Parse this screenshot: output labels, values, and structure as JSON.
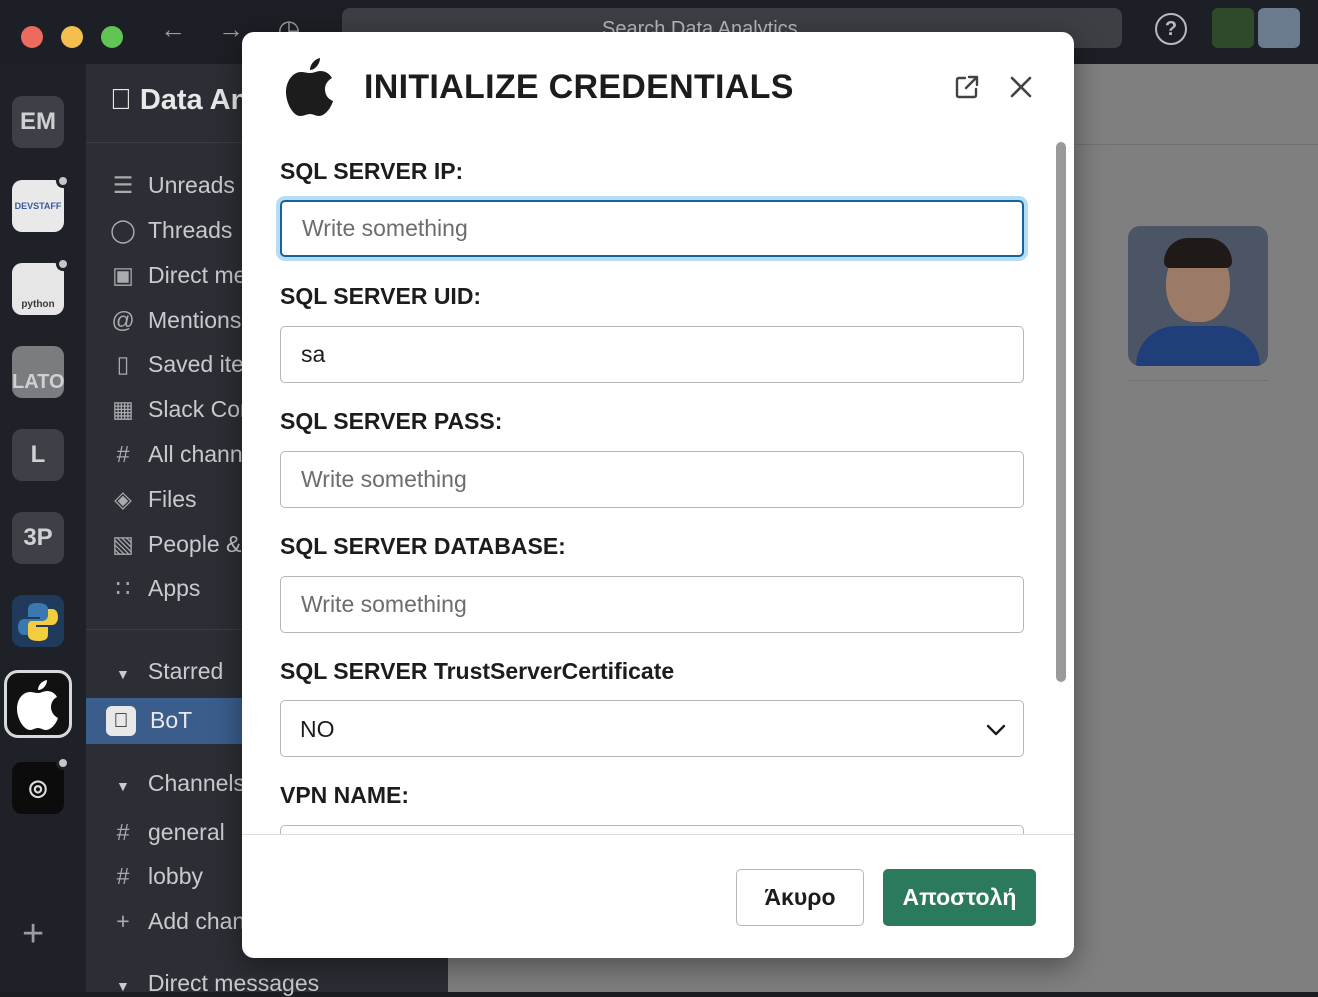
{
  "titlebar": {
    "search_text": "Search  Data Analytics",
    "help_label": "?"
  },
  "workspaces": [
    {
      "label": "EM"
    },
    {
      "label": "DEVSTAFF"
    },
    {
      "label": "python"
    },
    {
      "label": "LATO"
    },
    {
      "label": "L"
    },
    {
      "label": "3P"
    },
    {
      "label": ""
    },
    {
      "label": ""
    },
    {
      "label": ""
    }
  ],
  "workspace_add": "+",
  "sidebar": {
    "workspace_name": "Data Analytics",
    "items": [
      {
        "label": "Unreads",
        "icon": "unreads-icon"
      },
      {
        "label": "Threads",
        "icon": "threads-icon"
      },
      {
        "label": "Direct messages",
        "icon": "direct-messages-icon"
      },
      {
        "label": "Mentions & reactions",
        "icon": "mentions-icon"
      },
      {
        "label": "Saved items",
        "icon": "saved-icon"
      },
      {
        "label": "Slack Connect",
        "icon": "building-icon"
      },
      {
        "label": "All channels",
        "icon": "channels-icon"
      },
      {
        "label": "Files",
        "icon": "files-icon"
      },
      {
        "label": "People & user groups",
        "icon": "people-icon"
      },
      {
        "label": "Apps",
        "icon": "apps-icon"
      }
    ],
    "starred_label": "Starred",
    "starred_item": "BoT",
    "channels_label": "Channels",
    "channels": [
      "general",
      "lobby"
    ],
    "add_channels": "Add channels",
    "dm_label": "Direct messages"
  },
  "modal": {
    "title": "INITIALIZE CREDENTIALS",
    "fields": {
      "ip_label": "SQL SERVER IP:",
      "ip_placeholder": "Write something",
      "uid_label": "SQL SERVER UID:",
      "uid_value": "sa",
      "pass_label": "SQL SERVER PASS:",
      "pass_placeholder": "Write something",
      "db_label": "SQL SERVER DATABASE:",
      "db_placeholder": "Write something",
      "trust_label": "SQL SERVER TrustServerCertificate",
      "trust_value": "NO",
      "vpn_label": "VPN NAME:"
    },
    "cancel_label": "Άκυρο",
    "submit_label": "Αποστολή",
    "submit_color": "#2a7a5b"
  }
}
